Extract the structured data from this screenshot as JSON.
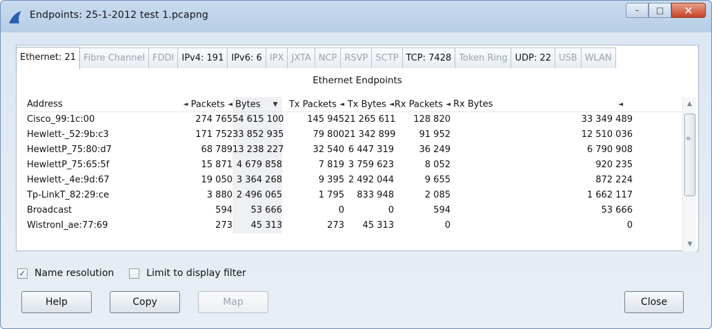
{
  "window": {
    "title": "Endpoints: 25-1-2012 test 1.pcapng",
    "controls": [
      "–",
      "□",
      "✕"
    ]
  },
  "tabs": [
    {
      "label": "Ethernet: 21",
      "enabled": true,
      "active": true
    },
    {
      "label": "Fibre Channel",
      "enabled": false
    },
    {
      "label": "FDDI",
      "enabled": false
    },
    {
      "label": "IPv4: 191",
      "enabled": true
    },
    {
      "label": "IPv6: 6",
      "enabled": true
    },
    {
      "label": "IPX",
      "enabled": false
    },
    {
      "label": "JXTA",
      "enabled": false
    },
    {
      "label": "NCP",
      "enabled": false
    },
    {
      "label": "RSVP",
      "enabled": false
    },
    {
      "label": "SCTP",
      "enabled": false
    },
    {
      "label": "TCP: 7428",
      "enabled": true
    },
    {
      "label": "Token Ring",
      "enabled": false
    },
    {
      "label": "UDP: 22",
      "enabled": true
    },
    {
      "label": "USB",
      "enabled": false
    },
    {
      "label": "WLAN",
      "enabled": false
    }
  ],
  "table": {
    "title": "Ethernet Endpoints",
    "columns": [
      "Address",
      "Packets",
      "Bytes",
      "Tx Packets",
      "Tx Bytes",
      "Rx Packets",
      "Rx Bytes"
    ],
    "rows": [
      [
        "Cisco_99:1c:00",
        "274 765",
        "54 615 100",
        "145 945",
        "21 265 611",
        "128 820",
        "33 349 489"
      ],
      [
        "Hewlett-_52:9b:c3",
        "171 752",
        "33 852 935",
        "79 800",
        "21 342 899",
        "91 952",
        "12 510 036"
      ],
      [
        "HewlettP_75:80:d7",
        "68 789",
        "13 238 227",
        "32 540",
        "6 447 319",
        "36 249",
        "6 790 908"
      ],
      [
        "HewlettP_75:65:5f",
        "15 871",
        "4 679 858",
        "7 819",
        "3 759 623",
        "8 052",
        "920 235"
      ],
      [
        "Hewlett-_4e:9d:67",
        "19 050",
        "3 364 268",
        "9 395",
        "2 492 044",
        "9 655",
        "872 224"
      ],
      [
        "Tp-LinkT_82:29:ce",
        "3 880",
        "2 496 065",
        "1 795",
        "833 948",
        "2 085",
        "1 662 117"
      ],
      [
        "Broadcast",
        "594",
        "53 666",
        "0",
        "0",
        "594",
        "53 666"
      ],
      [
        "WistronI_ae:77:69",
        "273",
        "45 313",
        "273",
        "45 313",
        "0",
        "0"
      ]
    ]
  },
  "options": {
    "name_resolution": {
      "label": "Name resolution",
      "checked": true
    },
    "limit_filter": {
      "label": "Limit to display filter",
      "checked": false
    }
  },
  "buttons": {
    "help": "Help",
    "copy": "Copy",
    "map": "Map",
    "close": "Close"
  }
}
